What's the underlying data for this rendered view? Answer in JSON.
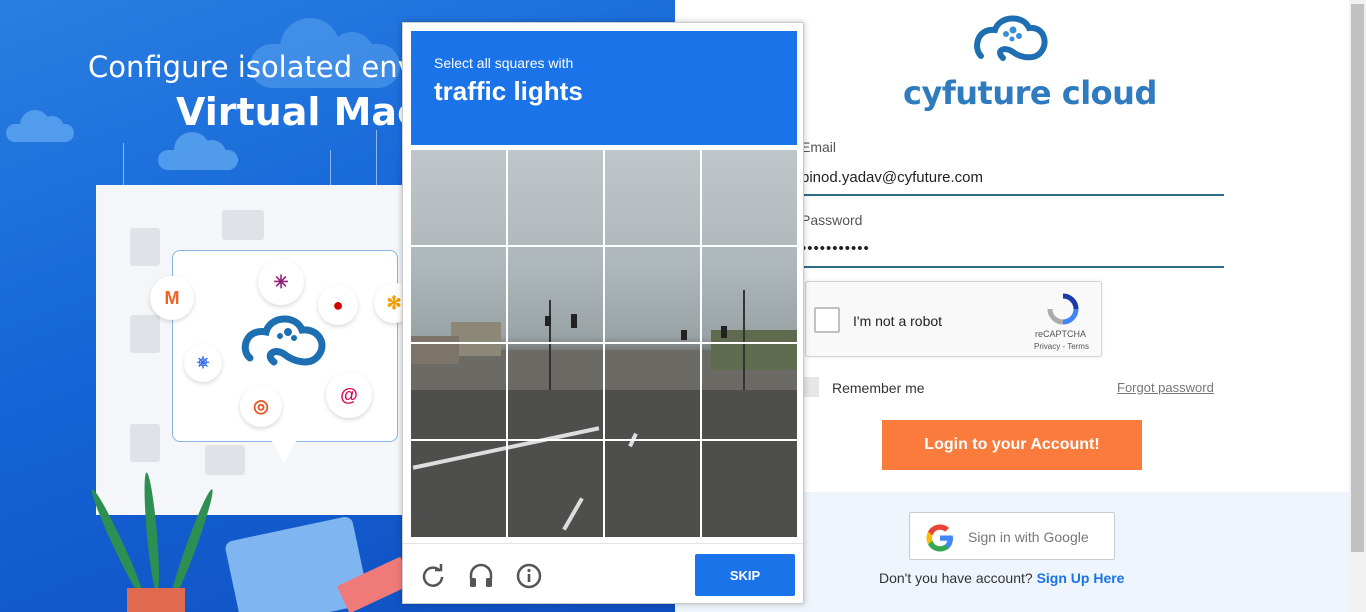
{
  "promo": {
    "headline": "Configure isolated envi",
    "headline_bold": "Virtual Mach"
  },
  "captcha_challenge": {
    "instruction": "Select all squares with",
    "target": "traffic lights",
    "skip_label": "SKIP",
    "icons": [
      "reload-icon",
      "audio-icon",
      "info-icon"
    ],
    "accent_color": "#1a73e8"
  },
  "login": {
    "brand": "cyfuture cloud",
    "email_label": "Email",
    "email_value": "binod.yadav@cyfuture.com",
    "password_label": "Password",
    "password_value": "•••••••••••",
    "recaptcha_label": "I'm not a robot",
    "recaptcha_brand": "reCAPTCHA",
    "recaptcha_links": "Privacy - Terms",
    "remember_label": "Remember me",
    "forgot_label": "Forgot password",
    "login_button": "Login to your Account!",
    "google_button": "Sign in with Google",
    "signup_prompt": "Don't you have account?",
    "signup_link": "Sign Up Here",
    "button_color": "#fb7b3c"
  }
}
